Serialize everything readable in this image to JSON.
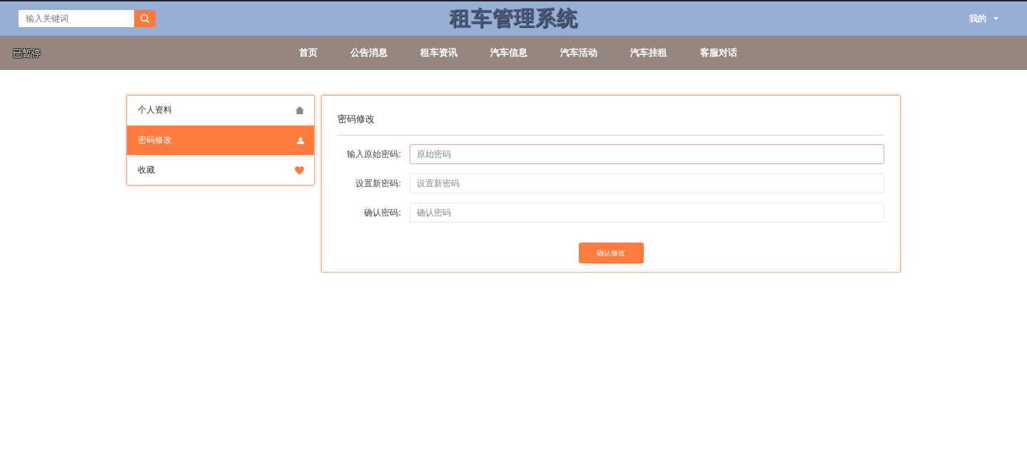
{
  "header": {
    "search": {
      "placeholder": "输入关键词"
    },
    "title": "租车管理系统",
    "user_menu": "我的"
  },
  "overlay_status": "已暂停",
  "nav": [
    {
      "label": "首页",
      "selected": false
    },
    {
      "label": "公告消息",
      "selected": false
    },
    {
      "label": "租车资讯",
      "selected": false
    },
    {
      "label": "汽车信息",
      "selected": false
    },
    {
      "label": "汽车活动",
      "selected": false
    },
    {
      "label": "汽车挂租",
      "selected": false
    },
    {
      "label": "客服对话",
      "selected": false
    }
  ],
  "sidebar": {
    "items": [
      {
        "label": "个人资料",
        "selected": false
      },
      {
        "label": "密码修改",
        "selected": true
      },
      {
        "label": "收藏",
        "selected": false
      }
    ]
  },
  "form": {
    "title": "密码修改",
    "fields": [
      {
        "label": "输入原始密码:",
        "placeholder": "原始密码",
        "focused": true
      },
      {
        "label": "设置新密码:",
        "placeholder": "设置新密码",
        "focused": false
      },
      {
        "label": "确认密码:",
        "placeholder": "确认密码",
        "focused": false
      }
    ],
    "submit": "确认修改"
  }
}
